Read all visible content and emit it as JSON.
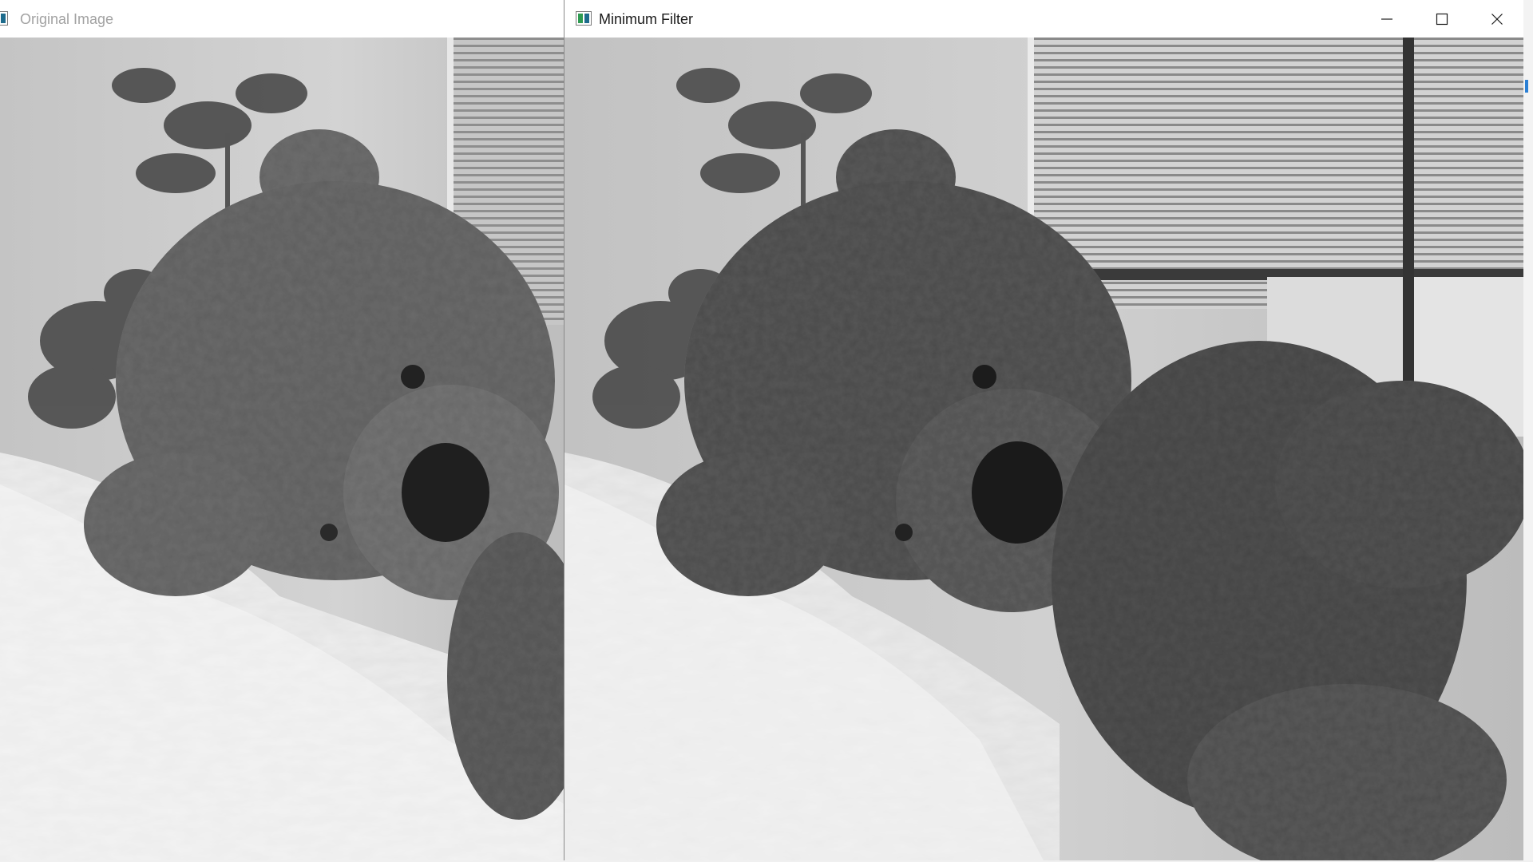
{
  "windows": {
    "left": {
      "title": "Original Image",
      "icon": "image-window-icon",
      "image_alt": "Grayscale photo of a teddy bear lying on a fluffy white rug near a plant"
    },
    "right": {
      "title": "Minimum Filter",
      "icon": "image-window-icon",
      "image_alt": "Minimum-filtered grayscale photo of a teddy bear near a window with blinds",
      "controls": {
        "minimize_icon": "minimize-icon",
        "maximize_icon": "maximize-icon",
        "close_icon": "close-icon"
      }
    }
  },
  "colors": {
    "titlebar_bg": "#ffffff",
    "inactive_title_text": "#a2a2a2",
    "active_title_text": "#1a1a1a",
    "icon_green": "#2e9b52",
    "icon_teal": "#1d6b8c"
  }
}
